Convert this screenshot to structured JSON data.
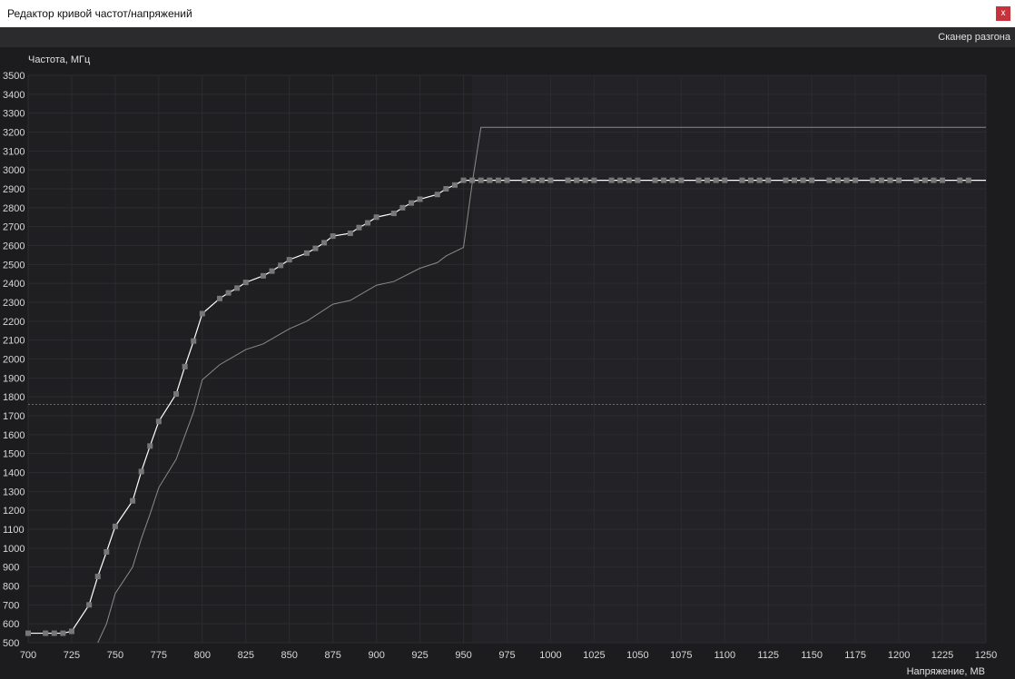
{
  "window": {
    "title": "Редактор кривой частот/напряжений",
    "close_label": "x"
  },
  "toolbar": {
    "scanner_label": "Сканер разгона"
  },
  "colors": {
    "background": "#1c1c1e",
    "locked_region": "#232327",
    "grid": "#2c2c30",
    "curve": "#ffffff",
    "point": "#777777",
    "reference": "#8a8a8a",
    "accent_close": "#c8323c"
  },
  "chart_data": {
    "type": "line",
    "xlabel": "Напряжение, МВ",
    "ylabel": "Частота, МГц",
    "xlim": [
      700,
      1250
    ],
    "ylim": [
      500,
      3500
    ],
    "x_ticks": [
      700,
      725,
      750,
      775,
      800,
      825,
      850,
      875,
      900,
      925,
      950,
      975,
      1000,
      1025,
      1050,
      1075,
      1100,
      1125,
      1150,
      1175,
      1200,
      1225,
      1250
    ],
    "y_ticks": [
      500,
      600,
      700,
      800,
      900,
      1000,
      1100,
      1200,
      1300,
      1400,
      1500,
      1600,
      1700,
      1800,
      1900,
      2000,
      2100,
      2200,
      2300,
      2400,
      2500,
      2600,
      2700,
      2800,
      2900,
      3000,
      3100,
      3200,
      3300,
      3400,
      3500
    ],
    "grid": true,
    "highlight_from_x": 955,
    "dotted_hline": 1760,
    "series": [
      {
        "values": [
          [
            700,
            550
          ],
          [
            710,
            550
          ],
          [
            715,
            550
          ],
          [
            720,
            550
          ],
          [
            725,
            560
          ],
          [
            735,
            700
          ],
          [
            740,
            850
          ],
          [
            745,
            980
          ],
          [
            750,
            1115
          ],
          [
            760,
            1250
          ],
          [
            765,
            1405
          ],
          [
            770,
            1540
          ],
          [
            775,
            1670
          ],
          [
            785,
            1815
          ],
          [
            790,
            1960
          ],
          [
            795,
            2095
          ],
          [
            800,
            2240
          ],
          [
            810,
            2320
          ],
          [
            815,
            2350
          ],
          [
            820,
            2375
          ],
          [
            825,
            2405
          ],
          [
            835,
            2440
          ],
          [
            840,
            2465
          ],
          [
            845,
            2495
          ],
          [
            850,
            2525
          ],
          [
            860,
            2560
          ],
          [
            865,
            2585
          ],
          [
            870,
            2615
          ],
          [
            875,
            2650
          ],
          [
            885,
            2665
          ],
          [
            890,
            2695
          ],
          [
            895,
            2720
          ],
          [
            900,
            2750
          ],
          [
            910,
            2770
          ],
          [
            915,
            2800
          ],
          [
            920,
            2825
          ],
          [
            925,
            2845
          ],
          [
            935,
            2870
          ],
          [
            940,
            2900
          ],
          [
            945,
            2920
          ],
          [
            950,
            2945
          ],
          [
            955,
            2945
          ],
          [
            960,
            2945
          ],
          [
            965,
            2945
          ],
          [
            970,
            2945
          ],
          [
            975,
            2945
          ],
          [
            985,
            2945
          ],
          [
            990,
            2945
          ],
          [
            995,
            2945
          ],
          [
            1000,
            2945
          ],
          [
            1010,
            2945
          ],
          [
            1015,
            2945
          ],
          [
            1020,
            2945
          ],
          [
            1025,
            2945
          ],
          [
            1035,
            2945
          ],
          [
            1040,
            2945
          ],
          [
            1045,
            2945
          ],
          [
            1050,
            2945
          ],
          [
            1060,
            2945
          ],
          [
            1065,
            2945
          ],
          [
            1070,
            2945
          ],
          [
            1075,
            2945
          ],
          [
            1085,
            2945
          ],
          [
            1090,
            2945
          ],
          [
            1095,
            2945
          ],
          [
            1100,
            2945
          ],
          [
            1110,
            2945
          ],
          [
            1115,
            2945
          ],
          [
            1120,
            2945
          ],
          [
            1125,
            2945
          ],
          [
            1135,
            2945
          ],
          [
            1140,
            2945
          ],
          [
            1145,
            2945
          ],
          [
            1150,
            2945
          ],
          [
            1160,
            2945
          ],
          [
            1165,
            2945
          ],
          [
            1170,
            2945
          ],
          [
            1175,
            2945
          ],
          [
            1185,
            2945
          ],
          [
            1190,
            2945
          ],
          [
            1195,
            2945
          ],
          [
            1200,
            2945
          ],
          [
            1210,
            2945
          ],
          [
            1215,
            2945
          ],
          [
            1220,
            2945
          ],
          [
            1225,
            2945
          ],
          [
            1235,
            2945
          ],
          [
            1240,
            2945
          ],
          [
            1250,
            2945
          ]
        ]
      },
      {
        "values": [
          [
            740,
            500
          ],
          [
            745,
            600
          ],
          [
            750,
            760
          ],
          [
            760,
            900
          ],
          [
            765,
            1050
          ],
          [
            770,
            1180
          ],
          [
            775,
            1320
          ],
          [
            785,
            1470
          ],
          [
            795,
            1720
          ],
          [
            800,
            1890
          ],
          [
            810,
            1970
          ],
          [
            825,
            2050
          ],
          [
            835,
            2080
          ],
          [
            850,
            2160
          ],
          [
            860,
            2200
          ],
          [
            875,
            2290
          ],
          [
            885,
            2310
          ],
          [
            900,
            2390
          ],
          [
            910,
            2410
          ],
          [
            925,
            2480
          ],
          [
            935,
            2510
          ],
          [
            940,
            2545
          ],
          [
            950,
            2590
          ],
          [
            955,
            2930
          ],
          [
            960,
            3225
          ],
          [
            1250,
            3225
          ]
        ]
      }
    ]
  }
}
